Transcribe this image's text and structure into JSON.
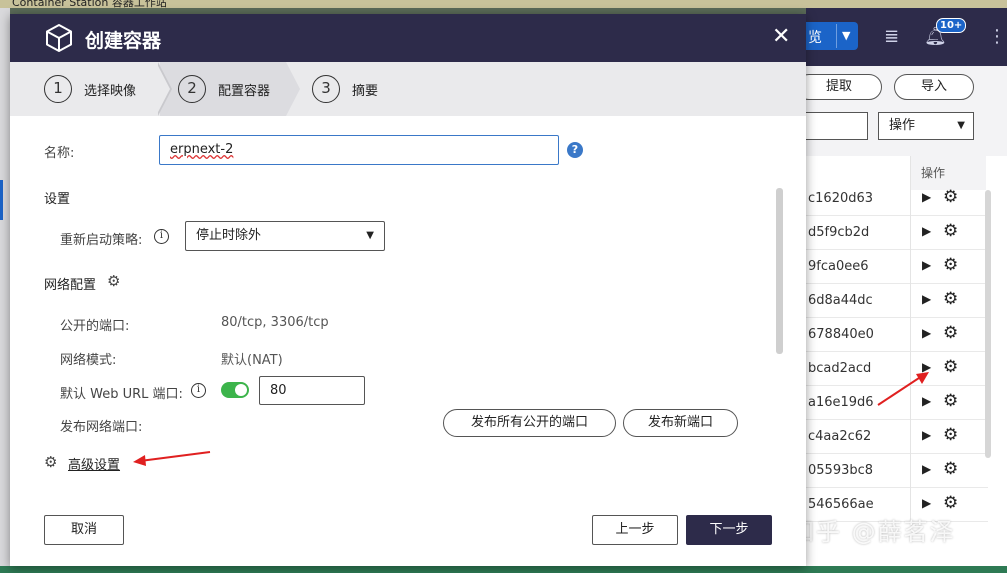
{
  "background": {
    "app_title": "Container Station 容器工作站",
    "header_button_label": "览",
    "notification_badge": "10+",
    "toolbar": {
      "fetch_label": "提取",
      "import_label": "导入",
      "action_select": "操作"
    },
    "column_header_action": "操作",
    "rows": [
      {
        "id": "c1620d63"
      },
      {
        "id": "d5f9cb2d"
      },
      {
        "id": "9fca0ee6"
      },
      {
        "id": "6d8a44dc"
      },
      {
        "id": "678840e0"
      },
      {
        "id": "bcad2acd"
      },
      {
        "id": "a16e19d6"
      },
      {
        "id": "c4aa2c62"
      },
      {
        "id": "05593bc8"
      },
      {
        "id": "546566ae"
      }
    ],
    "watermark": "知乎 @薛茗泽"
  },
  "modal": {
    "title": "创建容器",
    "steps": [
      {
        "num": "1",
        "label": "选择映像"
      },
      {
        "num": "2",
        "label": "配置容器"
      },
      {
        "num": "3",
        "label": "摘要"
      }
    ],
    "name_label": "名称:",
    "name_value": "erpnext-2",
    "help_icon": "?",
    "settings_title": "设置",
    "restart_policy_label": "重新启动策略:",
    "restart_policy_value": "停止时除外",
    "network_title": "网络配置",
    "public_ports_label": "公开的端口:",
    "public_ports_value": "80/tcp, 3306/tcp",
    "network_mode_label": "网络模式:",
    "network_mode_value": "默认(NAT)",
    "web_url_port_label": "默认 Web URL 端口:",
    "web_url_port_value": "80",
    "web_url_port_enabled": true,
    "publish_ports_label": "发布网络端口:",
    "publish_all_button": "发布所有公开的端口",
    "publish_new_button": "发布新端口",
    "advanced_settings_link": "高级设置",
    "cancel_button": "取消",
    "prev_button": "上一步",
    "next_button": "下一步"
  },
  "colors": {
    "header_bg": "#2d2b4a",
    "accent_blue": "#1b64c8",
    "toggle_on": "#3cb44b",
    "annotation_arrow": "#e02020"
  }
}
